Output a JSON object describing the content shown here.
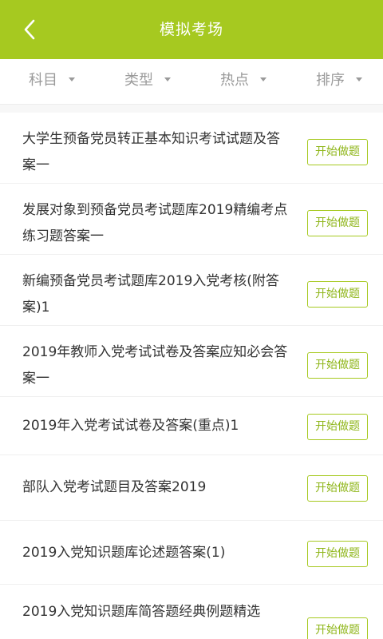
{
  "header": {
    "title": "模拟考场",
    "back_icon": "chevron-left-icon",
    "color": "#a6c920"
  },
  "filters": [
    {
      "label": "科目"
    },
    {
      "label": "类型"
    },
    {
      "label": "热点"
    },
    {
      "label": "排序"
    }
  ],
  "start_label": "开始做题",
  "items": [
    {
      "title": "大学生预备党员转正基本知识考试试题及答案一"
    },
    {
      "title": "发展对象到预备党员考试题库2019精编考点练习题答案一"
    },
    {
      "title": "新编预备党员考试题库2019入党考核(附答案)1"
    },
    {
      "title": "2019年教师入党考试试卷及答案应知必会答案一"
    },
    {
      "title": "2019年入党考试试卷及答案(重点)1"
    },
    {
      "title": "部队入党考试题目及答案2019"
    },
    {
      "title": "2019入党知识题库论述题答案(1)"
    },
    {
      "title": "2019入党知识题库简答题经典例题精选"
    }
  ]
}
